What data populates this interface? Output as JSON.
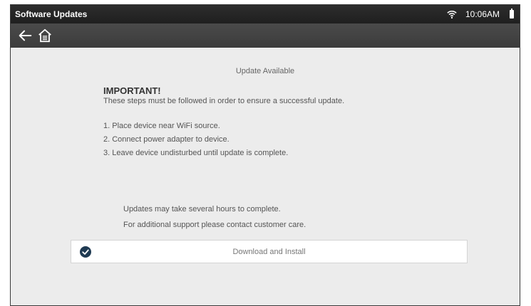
{
  "status_bar": {
    "title": "Software Updates",
    "time": "10:06AM",
    "wifi_icon": "wifi-icon",
    "battery_icon": "battery-icon"
  },
  "toolbar": {
    "back_icon": "back-arrow-icon",
    "home_icon": "home-icon"
  },
  "main": {
    "heading": "Update Available",
    "important_title": "IMPORTANT!",
    "important_text": "These steps must be followed in order to ensure a successful update.",
    "steps": [
      "1. Place device near WiFi source.",
      "2. Connect power adapter to device.",
      "3. Leave device undisturbed until update is complete."
    ],
    "note_duration": "Updates may take several hours to complete.",
    "note_support": "For additional support please contact customer care.",
    "install_button_label": "Download and Install",
    "install_icon": "check-circle-icon"
  },
  "colors": {
    "status_bar": "#222222",
    "toolbar": "#444444",
    "background": "#ececec",
    "check_icon": "#1f3a52"
  }
}
